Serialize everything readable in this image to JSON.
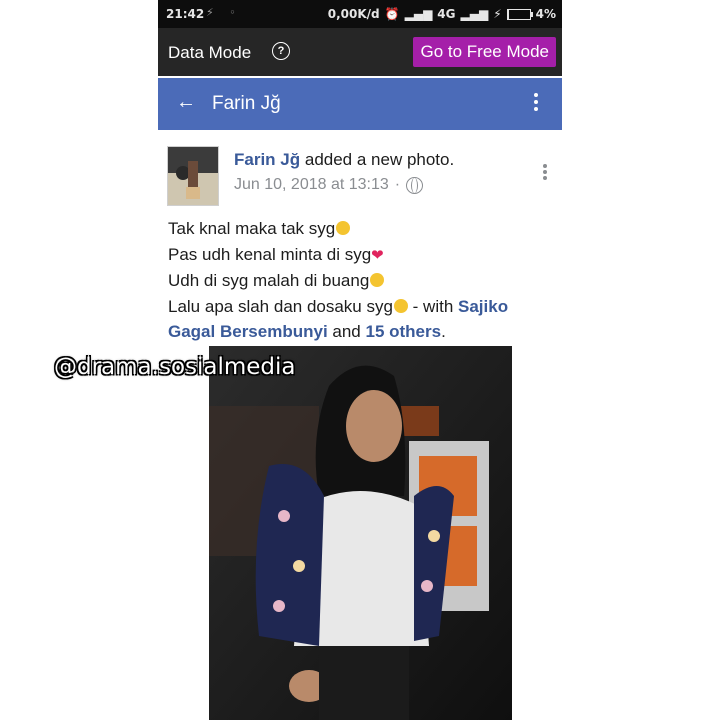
{
  "status_bar": {
    "time": "21:42",
    "network_speed": "0,00K/d",
    "network_type": "4G",
    "battery": "4%",
    "battery_level": 0.04
  },
  "data_mode_bar": {
    "label": "Data Mode",
    "help_icon": "?",
    "free_mode_button": "Go to Free Mode",
    "accent_color": "#a51fa9"
  },
  "nav_bar": {
    "title": "Farin Jğ",
    "color": "#4b6bb8"
  },
  "post": {
    "author": "Farin Jğ",
    "action": "added a new photo.",
    "date": "Jun 10, 2018 at 13:13",
    "separator": "·",
    "audience_icon": "globe-icon",
    "lines": [
      "Tak knal maka tak syg",
      "Pas udh kenal minta di syg",
      "Udh di syg malah di buang",
      "Lalu apa slah dan dosaku syg"
    ],
    "with_text": " - with ",
    "tagged": "Sajiko Gagal Bersembunyi",
    "and_text": " and ",
    "others": "15 others",
    "end": "."
  },
  "watermark": "@drama.sosialmedia"
}
